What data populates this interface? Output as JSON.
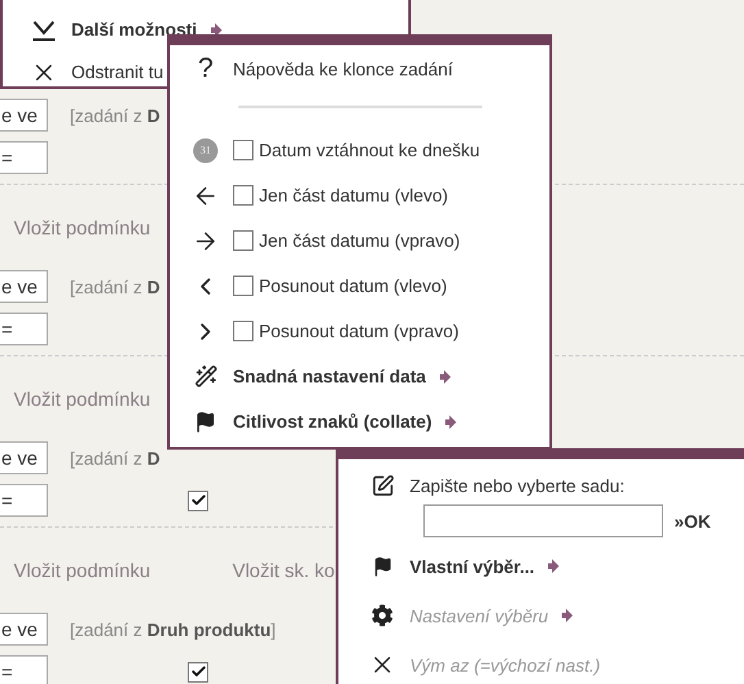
{
  "more_menu": {
    "items": [
      {
        "label": "Další možnosti",
        "kind": "submenu"
      },
      {
        "label": "Odstranit tu",
        "kind": "action"
      }
    ]
  },
  "conditions": [
    {
      "kind": "condition",
      "operator": "e ve",
      "source": "[zadání z **D**",
      "value": "="
    },
    {
      "kind": "actions",
      "links": [
        "Vložit podmínku"
      ]
    },
    {
      "kind": "condition",
      "operator": "e ve",
      "source": "[zadání z **D**",
      "value": "="
    },
    {
      "kind": "actions",
      "links": [
        "Vložit podmínku"
      ]
    },
    {
      "kind": "condition",
      "operator": "e ve",
      "source": "[zadání z **D**",
      "value": "=",
      "checked": true
    },
    {
      "kind": "actions",
      "links": [
        "Vložit podmínku",
        "Vložit sk. ko"
      ]
    },
    {
      "kind": "condition",
      "operator": "e ve",
      "source": "[zadání z **Druh produktu**]",
      "value": "=",
      "checked": true
    }
  ],
  "date_menu": {
    "items": [
      {
        "kind": "help",
        "symbol": "?",
        "label": "Nápověda ke klonce zadání"
      },
      {
        "kind": "separator"
      },
      {
        "kind": "option",
        "badge": "31",
        "label": "Datum vztáhnout ke dnešku",
        "checked": false
      },
      {
        "kind": "option",
        "label": "Jen část datumu (vlevo)",
        "checked": false
      },
      {
        "kind": "option",
        "label": "Jen část datumu (vpravo)",
        "checked": false
      },
      {
        "kind": "option",
        "label": "Posunout datum (vlevo)",
        "checked": false
      },
      {
        "kind": "option",
        "label": "Posunout datum (vpravo)",
        "checked": false
      },
      {
        "kind": "submenu",
        "label": "Snadná nastavení data"
      },
      {
        "kind": "submenu",
        "label": "Citlivost znaků (collate)"
      }
    ]
  },
  "set_menu": {
    "items": [
      {
        "kind": "set_input",
        "label": "Zapište nebo vyberte sadu:",
        "button": "»OK"
      },
      {
        "kind": "submenu",
        "label": "Vlastní výběr...",
        "disabled": false
      },
      {
        "kind": "submenu",
        "label": "Nastavení výběru",
        "disabled": true
      },
      {
        "kind": "action",
        "label": "Vým az (=výchozí nast.)",
        "disabled": true
      }
    ]
  }
}
